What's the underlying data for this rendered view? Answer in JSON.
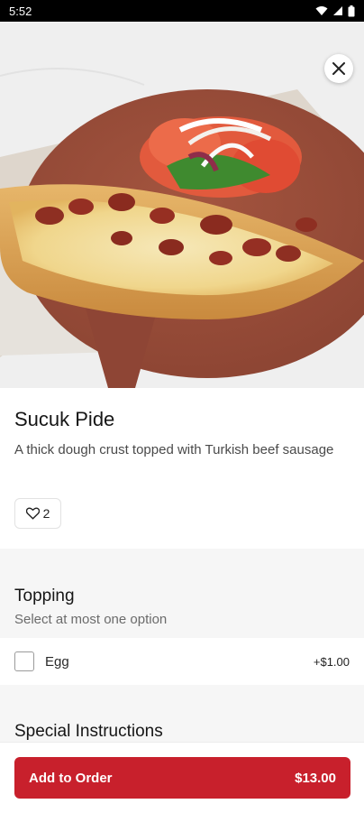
{
  "status_bar": {
    "time": "5:52",
    "icons": [
      "wifi-icon",
      "signal-icon",
      "battery-icon"
    ]
  },
  "hero": {
    "image": "Sucuk Pide photo",
    "close_icon": "close-icon"
  },
  "item": {
    "name": "Sucuk Pide",
    "description": "A thick dough crust topped with Turkish beef sausage",
    "likes": "2"
  },
  "topping": {
    "title": "Topping",
    "subtitle": "Select at most one option",
    "options": [
      {
        "label": "Egg",
        "price": "+$1.00",
        "checked": false
      }
    ]
  },
  "special_instructions": {
    "title": "Special Instructions"
  },
  "cta": {
    "label": "Add to Order",
    "price": "$13.00"
  },
  "colors": {
    "accent": "#c8202c",
    "band": "#f6f6f6"
  }
}
